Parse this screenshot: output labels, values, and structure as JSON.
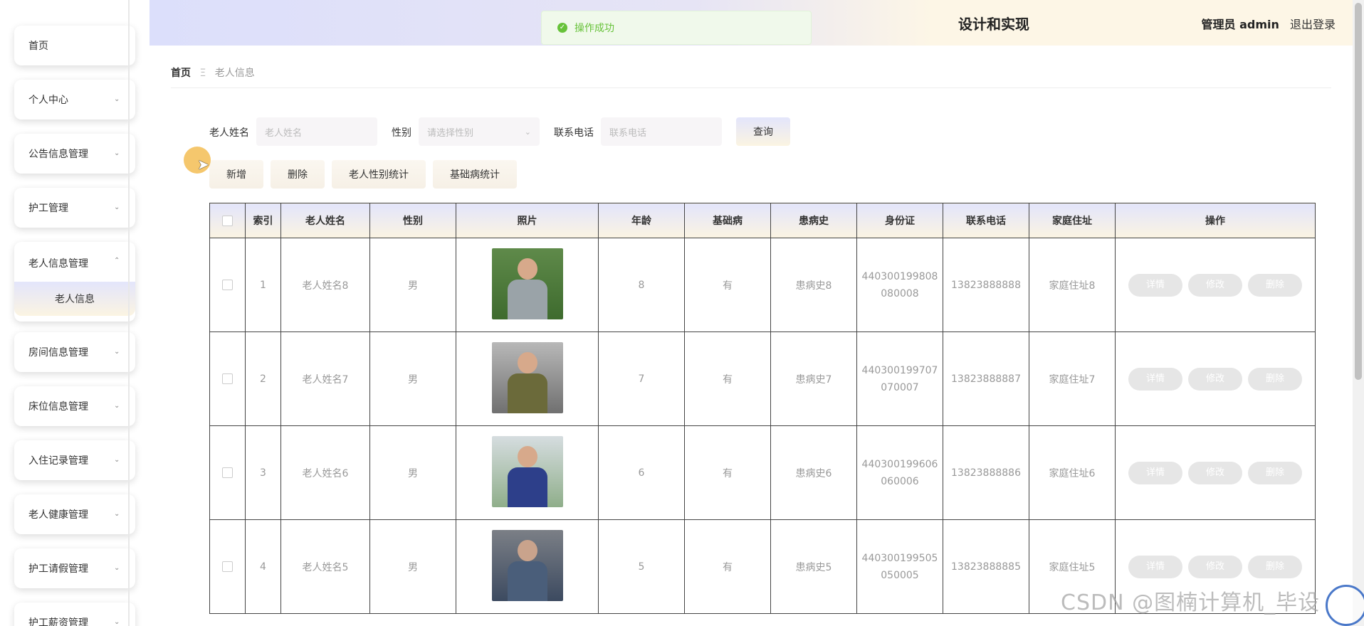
{
  "sidebar": {
    "items": [
      {
        "label": "首页"
      },
      {
        "label": "个人中心"
      },
      {
        "label": "公告信息管理"
      },
      {
        "label": "护工管理"
      },
      {
        "label": "老人信息管理",
        "sub": "老人信息"
      },
      {
        "label": "房间信息管理"
      },
      {
        "label": "床位信息管理"
      },
      {
        "label": "入住记录管理"
      },
      {
        "label": "老人健康管理"
      },
      {
        "label": "护工请假管理"
      },
      {
        "label": "护工薪资管理"
      }
    ]
  },
  "header": {
    "title": "设计和实现",
    "role": "管理员 admin",
    "logout": "退出登录"
  },
  "toast": {
    "message": "操作成功",
    "icon": "check-circle-icon"
  },
  "breadcrumb": {
    "home": "首页",
    "separator": "Ξ",
    "current": "老人信息"
  },
  "search": {
    "name_label": "老人姓名",
    "name_placeholder": "老人姓名",
    "gender_label": "性别",
    "gender_placeholder": "请选择性别",
    "phone_label": "联系电话",
    "phone_placeholder": "联系电话",
    "query_button": "查询"
  },
  "actions": {
    "add": "新增",
    "delete": "删除",
    "gender_stats": "老人性别统计",
    "disease_stats": "基础病统计"
  },
  "table": {
    "headers": [
      "索引",
      "老人姓名",
      "性别",
      "照片",
      "年龄",
      "基础病",
      "患病史",
      "身份证",
      "联系电话",
      "家庭住址",
      "操作"
    ],
    "rows": [
      {
        "index": "1",
        "name": "老人姓名8",
        "gender": "男",
        "age": "8",
        "disease": "有",
        "history": "患病史8",
        "id1": "440300199808",
        "id2": "080008",
        "phone": "13823888888",
        "address": "家庭住址8"
      },
      {
        "index": "2",
        "name": "老人姓名7",
        "gender": "男",
        "age": "7",
        "disease": "有",
        "history": "患病史7",
        "id1": "440300199707",
        "id2": "070007",
        "phone": "13823888887",
        "address": "家庭住址7"
      },
      {
        "index": "3",
        "name": "老人姓名6",
        "gender": "男",
        "age": "6",
        "disease": "有",
        "history": "患病史6",
        "id1": "440300199606",
        "id2": "060006",
        "phone": "13823888886",
        "address": "家庭住址6"
      },
      {
        "index": "4",
        "name": "老人姓名5",
        "gender": "男",
        "age": "5",
        "disease": "有",
        "history": "患病史5",
        "id1": "440300199505",
        "id2": "050005",
        "phone": "13823888885",
        "address": "家庭住址5"
      }
    ],
    "op_detail": "详情",
    "op_edit": "修改",
    "op_delete": "删除"
  },
  "watermark": "CSDN @图楠计算机_毕设",
  "colors": {
    "accent_start": "#e3e5fb",
    "accent_end": "#fbf4e2",
    "success": "#67c23a"
  }
}
